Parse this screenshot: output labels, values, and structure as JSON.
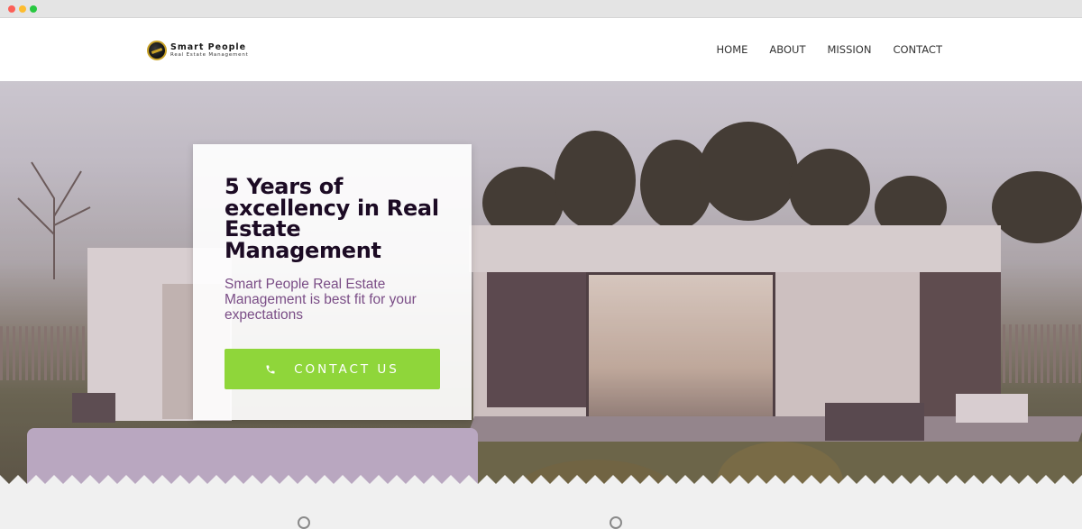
{
  "browser": {
    "window_dots": [
      "close",
      "minimize",
      "maximize"
    ]
  },
  "logo": {
    "title": "Smart People",
    "subtitle": "Real Estate Management"
  },
  "nav": {
    "items": [
      {
        "label": "HOME"
      },
      {
        "label": "ABOUT"
      },
      {
        "label": "MISSION"
      },
      {
        "label": "CONTACT"
      }
    ]
  },
  "hero": {
    "title": "5 Years of excellency in Real Estate Management",
    "subtitle": "Smart People Real Estate Management is best fit for your expectations",
    "cta_label": "CONTACT US",
    "cta_icon": "phone-icon",
    "cta_color": "#8fd63a",
    "title_color": "#1c0b24",
    "subtitle_color": "#7a4d86"
  }
}
